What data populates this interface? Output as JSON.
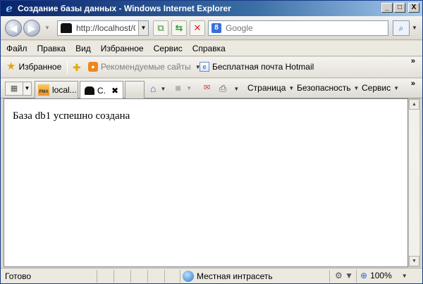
{
  "window": {
    "title": "Создание базы данных - Windows Internet Explorer",
    "controls": {
      "minimize": "_",
      "maximize": "□",
      "close": "X"
    }
  },
  "address": {
    "url": "http://localhost/C"
  },
  "search": {
    "placeholder": "Google"
  },
  "menu": {
    "items": [
      "Файл",
      "Правка",
      "Вид",
      "Избранное",
      "Сервис",
      "Справка"
    ]
  },
  "favorites_bar": {
    "favorites_label": "Избранное",
    "suggested_sites": "Рекомендуемые сайты",
    "hotmail": "Бесплатная почта Hotmail",
    "overflow": "»"
  },
  "tabs": [
    {
      "label": "local...",
      "icon": "phpmyadmin-icon",
      "icon_text": "PMA"
    },
    {
      "label": "С.",
      "icon": "hat-icon",
      "close": "✖"
    }
  ],
  "command_bar": {
    "page": "Страница",
    "safety": "Безопасность",
    "tools": "Сервис",
    "overflow": "»"
  },
  "content": {
    "message": "База db1 успешно создана"
  },
  "status_bar": {
    "status": "Готово",
    "zone": "Местная интрасеть",
    "zoom": "100%"
  },
  "colors": {
    "title_bar": "#0a246a",
    "chrome": "#d9d6cf",
    "content_bg": "#ffffff"
  }
}
